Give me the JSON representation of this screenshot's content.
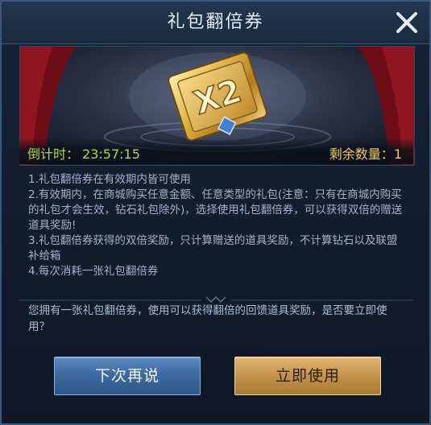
{
  "dialog": {
    "title": "礼包翻倍券",
    "close_icon": "close-icon"
  },
  "banner": {
    "coupon_icon": "double-coupon-icon",
    "coupon_mark": "X2",
    "countdown_label": "倒计时：",
    "countdown_value": "23:57:15",
    "remaining_label": "剩余数量：",
    "remaining_value": "1"
  },
  "rules": [
    "1.礼包翻倍券在有效期内皆可使用",
    "2.有效期内，在商城购买任意金额、任意类型的礼包(注意：只有在商城内购买的礼包才会生效，钻石礼包除外)，选择使用礼包翻倍券，可以获得双倍的赠送道具奖励!",
    "3.礼包翻倍券获得的双倍奖励，只计算赠送的道具奖励，不计算钻石以及联盟补给箱",
    "4.每次消耗一张礼包翻倍券"
  ],
  "question": "您拥有一张礼包翻倍券，使用可以获得翻倍的回馈道具奖励，是否要立即使用？",
  "buttons": {
    "later": "下次再说",
    "use": "立即使用"
  },
  "colors": {
    "countdown": "#a7d94a",
    "remaining": "#f0c95a",
    "later_button": "#3d6aa0",
    "use_button": "#c5954c"
  }
}
